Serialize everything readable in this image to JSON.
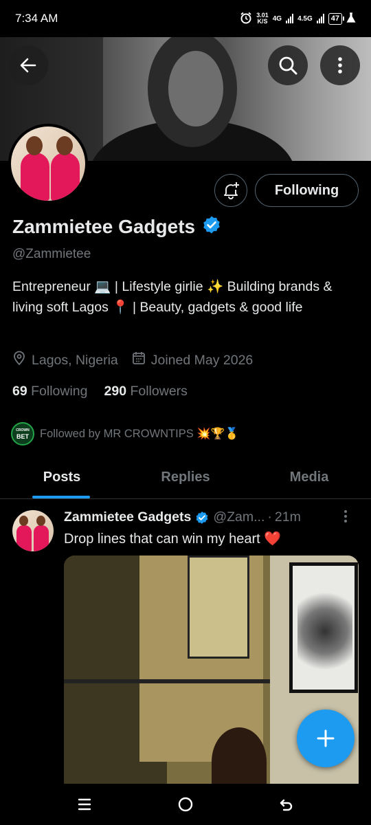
{
  "status_bar": {
    "time": "7:34 AM",
    "net_speed_value": "3.01",
    "net_speed_unit": "K/S",
    "net1": "4G",
    "net2": "4.5G",
    "battery": "47"
  },
  "profile": {
    "display_name": "Zammietee Gadgets",
    "handle": "@Zammietee",
    "bio": "Entrepreneur 💻 | Lifestyle girlie ✨ Building brands & living soft Lagos 📍 | Beauty, gadgets & good life",
    "location": "Lagos, Nigeria",
    "joined": "Joined May 2026",
    "following_count": "69",
    "following_label": "Following",
    "followers_count": "290",
    "followers_label": "Followers",
    "followed_by": "Followed by MR CROWNTIPS 💥🏆🥇",
    "crown_logo_top": "CROWN",
    "crown_logo_main": "BET",
    "follow_button_label": "Following"
  },
  "tabs": [
    {
      "label": "Posts",
      "active": true
    },
    {
      "label": "Replies",
      "active": false
    },
    {
      "label": "Media",
      "active": false
    }
  ],
  "post": {
    "author": "Zammietee Gadgets",
    "handle": "@Zam...",
    "dot": "·",
    "time": "21m",
    "text": "Drop lines that can win my heart ❤️"
  },
  "colors": {
    "accent": "#1d9bf0",
    "background": "#000000",
    "text_primary": "#e7e9ea",
    "text_secondary": "#71767b",
    "border": "#2f3336"
  }
}
